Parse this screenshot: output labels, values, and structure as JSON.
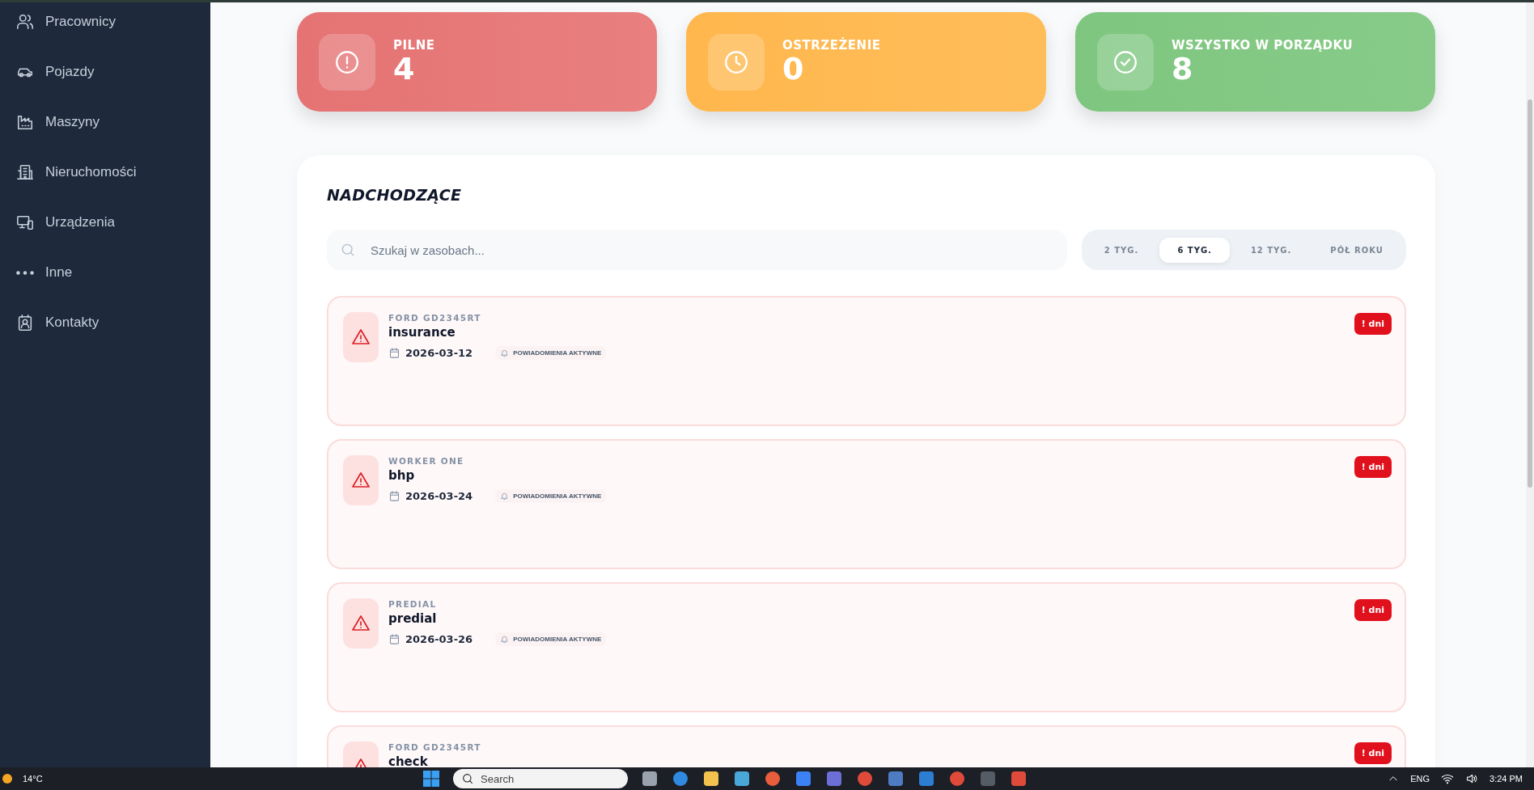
{
  "sidebar": {
    "items": [
      {
        "label": "Pracownicy"
      },
      {
        "label": "Pojazdy"
      },
      {
        "label": "Maszyny"
      },
      {
        "label": "Nieruchomości"
      },
      {
        "label": "Urządzenia"
      },
      {
        "label": "Inne"
      },
      {
        "label": "Kontakty"
      }
    ]
  },
  "stats": [
    {
      "kind": "urgent",
      "label": "PILNE",
      "value": "4"
    },
    {
      "kind": "warning",
      "label": "OSTRZEŻENIE",
      "value": "0"
    },
    {
      "kind": "ok",
      "label": "WSZYSTKO W PORZĄDKU",
      "value": "8"
    }
  ],
  "upcoming": {
    "title": "NADCHODZĄCE",
    "search": {
      "placeholder": "Szukaj w zasobach..."
    },
    "filters": [
      {
        "label": "2 TYG.",
        "selected": false
      },
      {
        "label": "6 TYG.",
        "selected": true
      },
      {
        "label": "12 TYG.",
        "selected": false
      },
      {
        "label": "PÓŁ ROKU",
        "selected": false
      }
    ],
    "items": [
      {
        "kind": "urgent",
        "category": "FORD GD2345RT",
        "title": "insurance",
        "date": "2026-03-12",
        "notice": "POWIADOMIENIA AKTYWNE",
        "badge": "! dni"
      },
      {
        "kind": "urgent",
        "category": "WORKER ONE",
        "title": "bhp",
        "date": "2026-03-24",
        "notice": "POWIADOMIENIA AKTYWNE",
        "badge": "! dni"
      },
      {
        "kind": "urgent",
        "category": "PREDIAL",
        "title": "predial",
        "date": "2026-03-26",
        "notice": "POWIADOMIENIA AKTYWNE",
        "badge": "! dni"
      },
      {
        "kind": "urgent",
        "category": "FORD GD2345RT",
        "title": "check",
        "badge": "! dni"
      }
    ]
  },
  "taskbar": {
    "weather": "14°C",
    "search": {
      "placeholder": "Search"
    },
    "language": "ENG",
    "time": "3:24 PM"
  }
}
